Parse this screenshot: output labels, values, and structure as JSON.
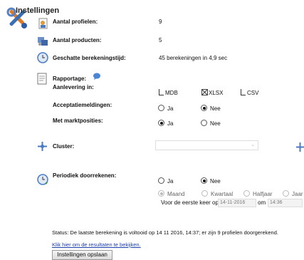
{
  "title": "Instellingen",
  "rows": {
    "profielen": {
      "label": "Aantal profielen:",
      "value": "9"
    },
    "producten": {
      "label": "Aantal producten:",
      "value": "5"
    },
    "tijd": {
      "label": "Geschatte berekeningstijd:",
      "value": "45 berekeningen in 4,9 sec"
    }
  },
  "rapportage": {
    "label": "Rapportage:",
    "aanlevering_label": "Aanlevering in:",
    "formats": [
      {
        "label": "MDB",
        "checked": false
      },
      {
        "label": "XLSX",
        "checked": true
      },
      {
        "label": "CSV",
        "checked": false
      }
    ],
    "acceptatie": {
      "label": "Acceptatiemeldingen:",
      "ja": "Ja",
      "nee": "Nee",
      "selected": "Nee"
    },
    "marktposities": {
      "label": "Met marktposities:",
      "ja": "Ja",
      "nee": "Nee",
      "selected": "Ja"
    }
  },
  "cluster": {
    "label": "Cluster:",
    "value": ""
  },
  "periodiek": {
    "label": "Periodiek doorrekenen:",
    "ja": "Ja",
    "nee": "Nee",
    "selected": "Nee",
    "frequency": [
      "Maand",
      "Kwartaal",
      "Halfjaar",
      "Jaar"
    ],
    "frequency_selected": "Maand",
    "first_time_label": "Voor de eerste keer op",
    "date": "14-11-2016",
    "om_label": "om",
    "time": "14:36"
  },
  "status_text": "Status: De laatste berekening is voltooid op 14 11 2016, 14:37; er zijn 9 profielen doorgerekend.",
  "results_link": "Klik hier om de resultaten te bekijken.",
  "save_button": "Instellingen opslaan",
  "icons": {
    "settings": "wrench-screwdriver-icon",
    "profiles": "user-document-icon",
    "products": "products-icon",
    "time": "clock-icon",
    "report": "report-document-icon",
    "help": "speech-bubble-icon",
    "cluster": "cluster-icon",
    "periodic": "refresh-clock-icon"
  }
}
